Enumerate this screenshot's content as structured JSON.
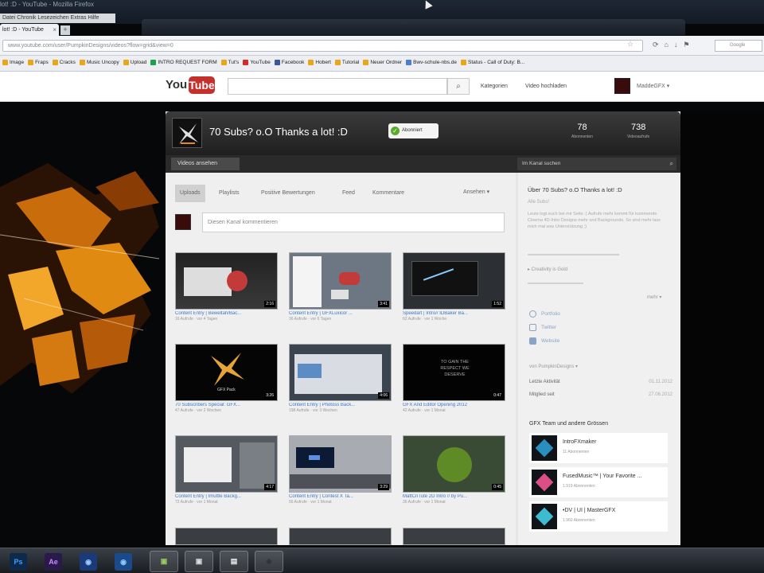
{
  "window": {
    "title": "lot! :D - YouTube - Mozilla Firefox",
    "menu": "Datei  Chronik  Lesezeichen  Extras  Hilfe"
  },
  "tab": {
    "label": "lot! :D - YouTube",
    "new_tab": "+"
  },
  "address": {
    "url": "www.youtube.com/user/PumpkinDesigns/videos?flow=grid&view=0",
    "search_engine": "Google"
  },
  "bookmarks": [
    {
      "label": "Image",
      "color": "#e7a61b"
    },
    {
      "label": "Fraps",
      "color": "#e7a61b"
    },
    {
      "label": "Cracks",
      "color": "#e7a61b"
    },
    {
      "label": "Music Uncopy",
      "color": "#e7a61b"
    },
    {
      "label": "Upload",
      "color": "#e7a61b"
    },
    {
      "label": "INTRO REQUEST FORM",
      "color": "#1aa34a"
    },
    {
      "label": "Tut's",
      "color": "#e7a61b"
    },
    {
      "label": "YouTube",
      "color": "#d42a2a"
    },
    {
      "label": "Facebook",
      "color": "#3b5998"
    },
    {
      "label": "Hobert",
      "color": "#e7a61b"
    },
    {
      "label": "Tutorial",
      "color": "#e7a61b"
    },
    {
      "label": "Neuer Ordner",
      "color": "#e7a61b"
    },
    {
      "label": "Bwv-schule-nbs.de",
      "color": "#4a7fd1"
    },
    {
      "label": "Status - Call of Duty: B...",
      "color": "#e7a61b"
    }
  ],
  "yt": {
    "header": {
      "logo_you": "You",
      "logo_tube": "Tube",
      "search_icon": "⌕",
      "categories": "Kategorien",
      "upload": "Video hochladen",
      "user": "MaddeGFX ▾"
    },
    "channel": {
      "title": "70 Subs? o.O Thanks a lot! :D",
      "subscribed": "Abonniert",
      "subscribers": "78",
      "subscribers_label": "Abonnenten",
      "views": "738",
      "views_label": "Videoaufrufe",
      "videos_button": "Videos ansehen",
      "search_placeholder": "Im Kanal suchen"
    },
    "subtabs": [
      "Uploads",
      "Playlists",
      "Positive Bewertungen",
      "Feed",
      "Kommentare"
    ],
    "sort": "Ansehen ▾",
    "comment_placeholder": "Diesen Kanal kommentieren",
    "videos": [
      {
        "title": "Content Entry | Beweltah/Bac...",
        "meta": "16 Aufrufe  ·  vor 4 Tagen",
        "duration": "2:16",
        "style": "dark"
      },
      {
        "title": "Content Entry | GFXLuxicor ...",
        "meta": "36 Aufrufe  ·  vor 6 Tagen",
        "duration": "3:41",
        "style": "screen"
      },
      {
        "title": "Speedart | Intro// IDBaker Ba...",
        "meta": "62 Aufrufe  ·  vor 1 Woche",
        "duration": "1:52",
        "style": "dark2"
      },
      {
        "title": "70 Subscribers Special: GFX...",
        "meta": "47 Aufrufe  ·  vor 2 Wochen",
        "duration": "3:26",
        "style": "logo"
      },
      {
        "title": "Content Entry | Photoss Back...",
        "meta": "198 Aufrufe  ·  vor 3 Wochen",
        "duration": "4:06",
        "style": "screen2"
      },
      {
        "title": "GFX And Editor Opening 2012",
        "meta": "42 Aufrufe  ·  vor 1 Monat",
        "duration": "0:47",
        "style": "text"
      },
      {
        "title": "Content Entry | Imuttle Backg...",
        "meta": "72 Aufrufe  ·  vor 1 Monat",
        "duration": "4:17",
        "style": "screen3"
      },
      {
        "title": "Content Entry | Contest X Ta...",
        "meta": "56 Aufrufe  ·  vor 1 Monat",
        "duration": "3:29",
        "style": "screen4"
      },
      {
        "title": "MattCnTute 2D Intro // by Pu...",
        "meta": "36 Aufrufe  ·  vor 1 Monat",
        "duration": "0:45",
        "style": "green"
      }
    ],
    "thumb_text": {
      "logo_caption": "GFX Pack",
      "text_lines": [
        "TO GAIN THE",
        "RESPECT WE",
        "DESERVE"
      ]
    },
    "side": {
      "title": "Über 70 Subs? o.O Thanks a lot! :D",
      "sub": "Alle Subs!",
      "desc": "Leute logt euch bei mir Seite :) Aufrufe mehr kommt für kommende Cinema 4D-Intro Designs mehr und Backgrounds. So sind mehr lass mich mal was Unterstützung ;)",
      "show_more": "▸ Creativity is Gold",
      "more": "mehr ▾",
      "links": [
        "Portfolio",
        "Twitter",
        "Website"
      ],
      "owner": "von PumpkinDesigns ▾",
      "last_active": "Letzte Aktivität",
      "last_active_date": "01.11.2012",
      "member_since": "Mitglied seit",
      "member_since_date": "27.06.2012",
      "featured_title": "GFX Team und andere Grössen",
      "featured": [
        {
          "name": "IntroFXmaker",
          "subs": "11 Abonnenten",
          "color": "#2a8ec0"
        },
        {
          "name": "FusedMusic™ | Your Favorite ...",
          "subs": "1.919 Abonnenten",
          "color": "#d94f86"
        },
        {
          "name": "•DV | UI | MasterGFX",
          "subs": "1.960 Abonnenten",
          "color": "#3dbbd1"
        }
      ]
    }
  },
  "taskbar": [
    "Ps",
    "Ae",
    "◉",
    "◉",
    "▣",
    "▣",
    "▤",
    "◈"
  ]
}
